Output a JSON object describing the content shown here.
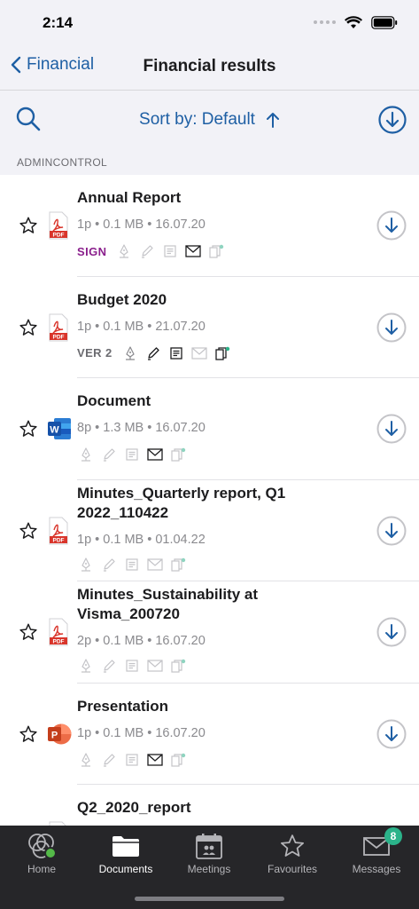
{
  "status_bar": {
    "time": "2:14"
  },
  "header": {
    "back_label": "Financial",
    "title": "Financial results"
  },
  "toolbar": {
    "sort_label": "Sort by: Default"
  },
  "section": {
    "label": "ADMINCONTROL"
  },
  "documents": [
    {
      "title": "Annual Report",
      "meta": "1p • 0.1 MB • 16.07.20",
      "type": "pdf-icon",
      "badge": "SIGN"
    },
    {
      "title": "Budget 2020",
      "meta": "1p • 0.1 MB • 21.07.20",
      "type": "pdf-icon",
      "badge": "VER 2"
    },
    {
      "title": "Document",
      "meta": "8p • 1.3 MB • 16.07.20",
      "type": "word-icon",
      "badge": ""
    },
    {
      "title": "Minutes_Quarterly report, Q1 2022_110422",
      "meta": "1p • 0.1 MB • 01.04.22",
      "type": "pdf-icon",
      "badge": ""
    },
    {
      "title": "Minutes_Sustainability at Visma_200720",
      "meta": "2p • 0.1 MB • 16.07.20",
      "type": "pdf-icon",
      "badge": ""
    },
    {
      "title": "Presentation",
      "meta": "1p • 0.1 MB • 16.07.20",
      "type": "powerpoint-icon",
      "badge": ""
    },
    {
      "title": "Q2_2020_report",
      "meta": "",
      "type": "pdf-icon",
      "badge": ""
    }
  ],
  "file_icon_text": {
    "pdf": "PDF",
    "word": "W",
    "powerpoint": "P"
  },
  "tabs": [
    {
      "label": "Home"
    },
    {
      "label": "Documents"
    },
    {
      "label": "Meetings"
    },
    {
      "label": "Favourites"
    },
    {
      "label": "Messages"
    }
  ],
  "messages_badge": "8",
  "colors": {
    "accent": "#1e5fa4",
    "sign": "#8a1f8c",
    "tabbar": "#262629",
    "badge_green": "#2bb38a"
  }
}
